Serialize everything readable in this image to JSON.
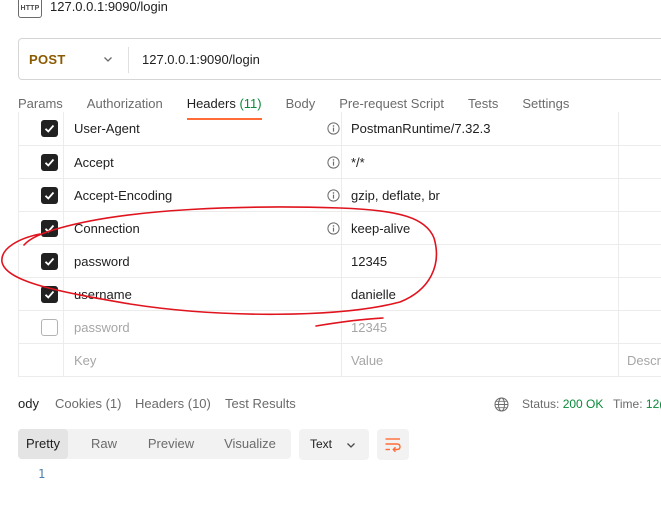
{
  "window": {
    "http_icon_text": "HTTP",
    "title": "127.0.0.1:9090/login"
  },
  "request": {
    "method": "POST",
    "url": "127.0.0.1:9090/login"
  },
  "request_tabs": [
    {
      "label": "Params",
      "active": false
    },
    {
      "label": "Authorization",
      "active": false
    },
    {
      "label": "Headers",
      "count": "(11)",
      "active": true
    },
    {
      "label": "Body",
      "active": false
    },
    {
      "label": "Pre-request Script",
      "active": false
    },
    {
      "label": "Tests",
      "active": false
    },
    {
      "label": "Settings",
      "active": false
    }
  ],
  "headers_table": {
    "rows": [
      {
        "checked": true,
        "key": "User-Agent",
        "value": "PostmanRuntime/7.32.3",
        "info": true
      },
      {
        "checked": true,
        "key": "Accept",
        "value": "*/*",
        "info": true
      },
      {
        "checked": true,
        "key": "Accept-Encoding",
        "value": "gzip, deflate, br",
        "info": true
      },
      {
        "checked": true,
        "key": "Connection",
        "value": "keep-alive",
        "info": true
      },
      {
        "checked": true,
        "key": "password",
        "value": "12345",
        "info": false
      },
      {
        "checked": true,
        "key": "username",
        "value": "danielle",
        "info": false
      },
      {
        "checked": false,
        "key": "password",
        "value": "12345",
        "info": false
      }
    ],
    "placeholder": {
      "key": "Key",
      "value": "Value",
      "description": "Descri"
    }
  },
  "response": {
    "tabs": [
      {
        "label": "ody",
        "active": true
      },
      {
        "label": "Cookies (1)",
        "active": false
      },
      {
        "label": "Headers (10)",
        "active": false
      },
      {
        "label": "Test Results",
        "active": false
      }
    ],
    "status_label": "Status:",
    "status_value": "200 OK",
    "time_label": "Time:",
    "time_value": "12(",
    "views": [
      "Pretty",
      "Raw",
      "Preview",
      "Visualize"
    ],
    "active_view": "Pretty",
    "format": "Text",
    "line_number": "1"
  },
  "colors": {
    "accent_tab_underline": "#ff6c37",
    "method_post": "#8a5a00",
    "success_green": "#0a8a3a",
    "annotation_red": "#e0141e"
  }
}
